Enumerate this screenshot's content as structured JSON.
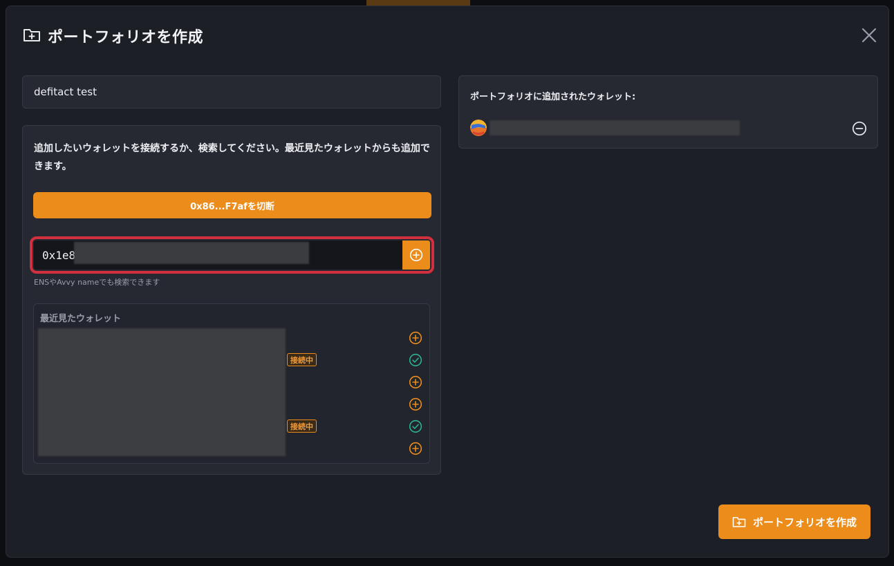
{
  "header": {
    "title": "ポートフォリオを作成",
    "icon": "folder-plus-icon",
    "close_icon": "close-icon"
  },
  "portfolio_name": {
    "value": "defitact test"
  },
  "search": {
    "instructions": "追加したいウォレットを接続するか、検索してください。最近見たウォレットからも追加できます。",
    "disconnect_label": "0x86...F7afを切断",
    "address_value": "0x1e8",
    "hint": "ENSやAvvy nameでも検索できます",
    "add_icon": "plus-circle-icon"
  },
  "recent": {
    "title": "最近見たウォレット",
    "rows": [
      {
        "badge": "",
        "action": "add",
        "icon": "plus-circle-icon"
      },
      {
        "badge": "接続中",
        "action": "added",
        "icon": "check-circle-icon"
      },
      {
        "badge": "",
        "action": "add",
        "icon": "plus-circle-icon"
      },
      {
        "badge": "",
        "action": "add",
        "icon": "plus-circle-icon"
      },
      {
        "badge": "接続中",
        "action": "added",
        "icon": "check-circle-icon"
      },
      {
        "badge": "",
        "action": "add",
        "icon": "plus-circle-icon"
      }
    ]
  },
  "added_wallets": {
    "title": "ポートフォリオに追加されたウォレット:",
    "remove_icon": "minus-circle-icon"
  },
  "footer": {
    "create_label": "ポートフォリオを作成"
  },
  "colors": {
    "accent": "#ec8c1a",
    "success": "#2bb38a",
    "highlight": "#d3303f",
    "background": "#1d1f27"
  }
}
